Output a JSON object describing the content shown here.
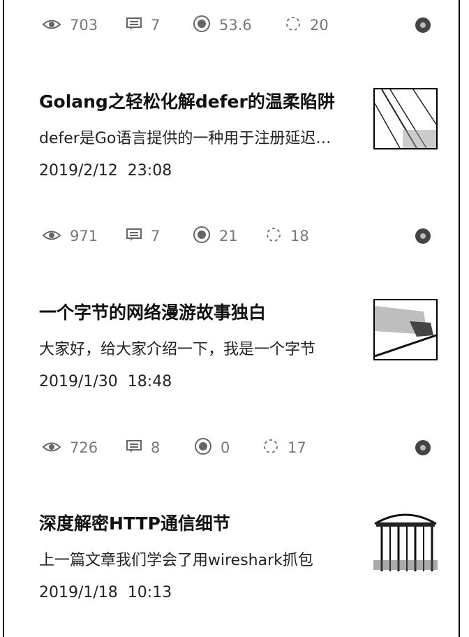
{
  "articles": [
    {
      "stats": {
        "views": "703",
        "comments": "7",
        "likes": "53.6",
        "shares": "20"
      }
    },
    {
      "title": "Golang之轻松化解defer的温柔陷阱",
      "summary": "defer是Go语言提供的一种用于注册延迟调用的机制",
      "date": "2019/2/12  23:08",
      "thumb_icon": "diagonal-stripes-thumbnail",
      "stats": {
        "views": "971",
        "comments": "7",
        "likes": "21",
        "shares": "18"
      }
    },
    {
      "title": "一个字节的网络漫游故事独白",
      "summary": "大家好，给大家介绍一下，我是一个字节",
      "date": "2019/1/30  18:48",
      "thumb_icon": "bottle-thumbnail",
      "stats": {
        "views": "726",
        "comments": "8",
        "likes": "0",
        "shares": "17"
      }
    },
    {
      "title": "深度解密HTTP通信细节",
      "summary": "上一篇文章我们学会了用wireshark抓包",
      "date": "2019/1/18  10:13",
      "thumb_icon": "building-thumbnail"
    }
  ]
}
